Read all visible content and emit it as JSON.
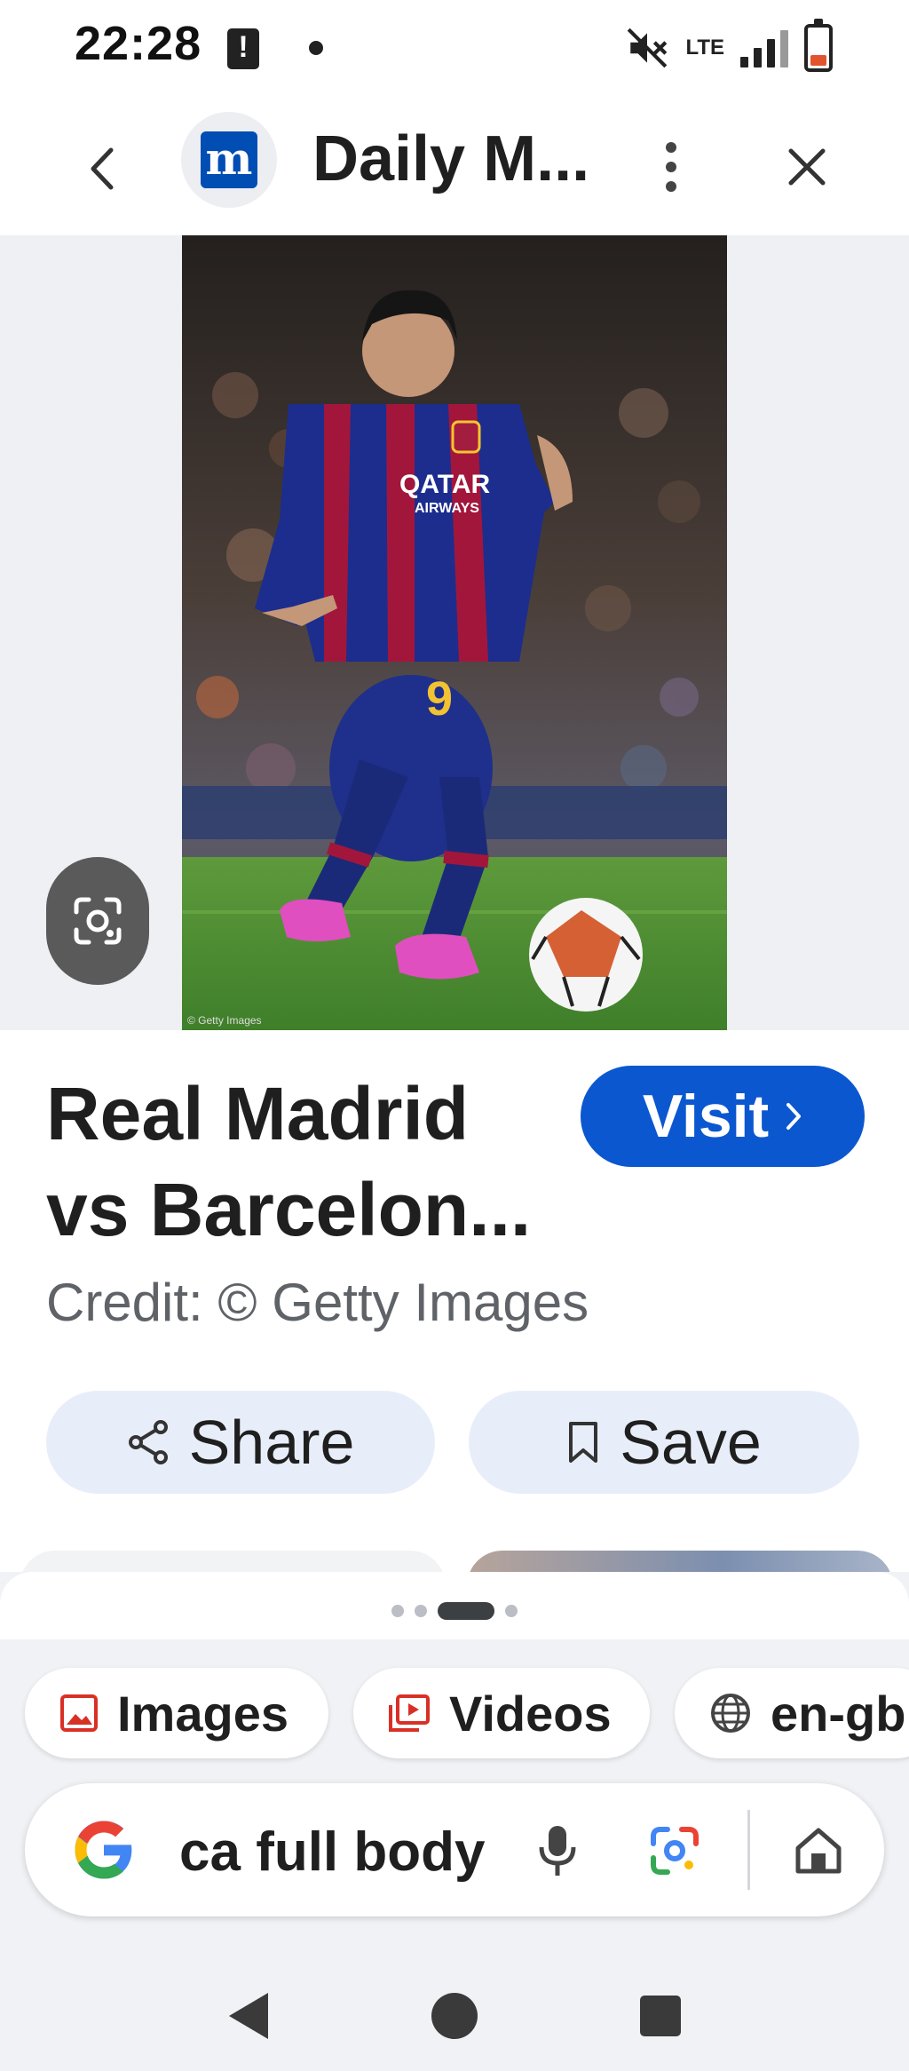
{
  "status_bar": {
    "time": "22:28",
    "network": "LTE"
  },
  "header": {
    "site_title": "Daily M...",
    "logo_letter": "m"
  },
  "image": {
    "description_icon": "google-lens-icon"
  },
  "result": {
    "title": "Real Madrid vs Barcelon...",
    "credit": "Credit: © Getty Images",
    "visit_label": "Visit",
    "share_label": "Share",
    "save_label": "Save"
  },
  "carousel": {
    "page_count": 4,
    "active_index": 2
  },
  "filters": [
    {
      "label": "Images",
      "icon": "image-icon"
    },
    {
      "label": "Videos",
      "icon": "video-icon"
    },
    {
      "label": "en-gb",
      "icon": "globe-icon"
    }
  ],
  "search": {
    "query": "ca full body"
  },
  "colors": {
    "accent": "#0b57d0",
    "pill_bg": "#e8eef9",
    "sheet_bg": "#f0f2f5",
    "chip_icon_red": "#d93025"
  }
}
